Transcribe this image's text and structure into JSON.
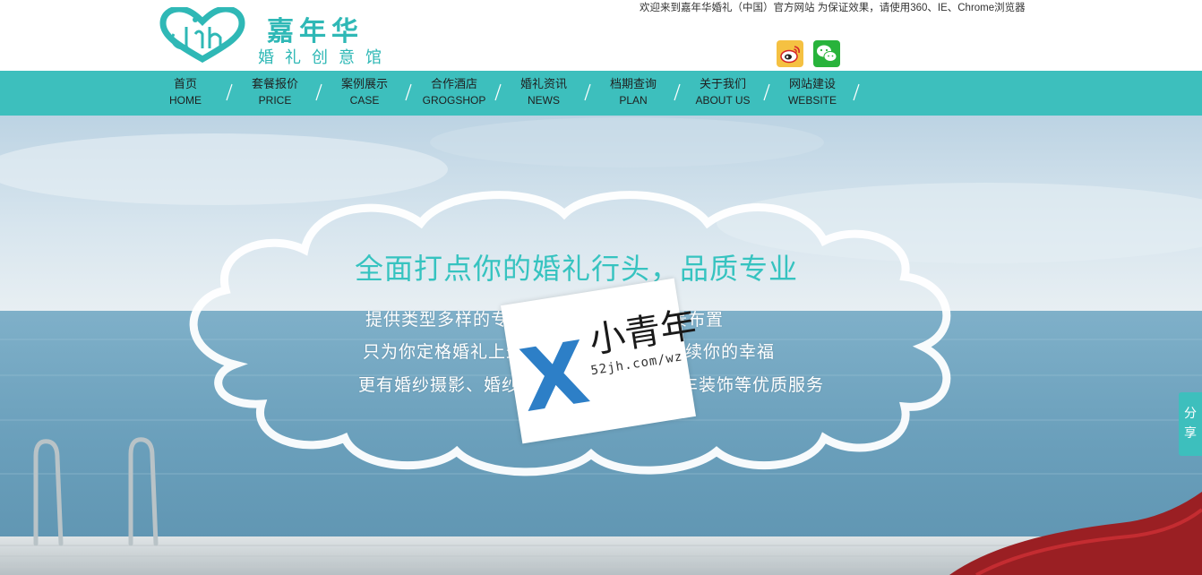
{
  "header": {
    "logo_title": "嘉年华",
    "logo_subtitle": "婚礼创意馆",
    "welcome_text": "欢迎来到嘉年华婚礼（中国）官方网站 为保证效果，请使用360、IE、Chrome浏览器",
    "social": [
      {
        "name": "weibo-icon"
      },
      {
        "name": "wechat-icon"
      }
    ]
  },
  "nav": {
    "items": [
      {
        "cn": "首页",
        "en": "HOME"
      },
      {
        "cn": "套餐报价",
        "en": "PRICE"
      },
      {
        "cn": "案例展示",
        "en": "CASE"
      },
      {
        "cn": "合作酒店",
        "en": "GROGSHOP"
      },
      {
        "cn": "婚礼资讯",
        "en": "NEWS"
      },
      {
        "cn": "档期查询",
        "en": "PLAN"
      },
      {
        "cn": "关于我们",
        "en": "ABOUT US"
      },
      {
        "cn": "网站建设",
        "en": "WEBSITE"
      }
    ]
  },
  "banner": {
    "headline": "全面打点你的婚礼行头，品质专业",
    "line1": "提供类型多样的专业婚礼设计、婚礼场景布置",
    "line2": "只为你定格婚礼上最真实的美好瞬间，延续你的幸福",
    "line3": "更有婚纱摄影、婚纱礼服、新娘化妆、花车装饰等优质服务"
  },
  "watermark": {
    "letter": "X",
    "brand": "小青年",
    "url": "52jh.com/wz"
  },
  "share": {
    "char1": "分",
    "char2": "享"
  },
  "colors": {
    "accent": "#3dbfbd",
    "headline": "#36c3c0"
  }
}
